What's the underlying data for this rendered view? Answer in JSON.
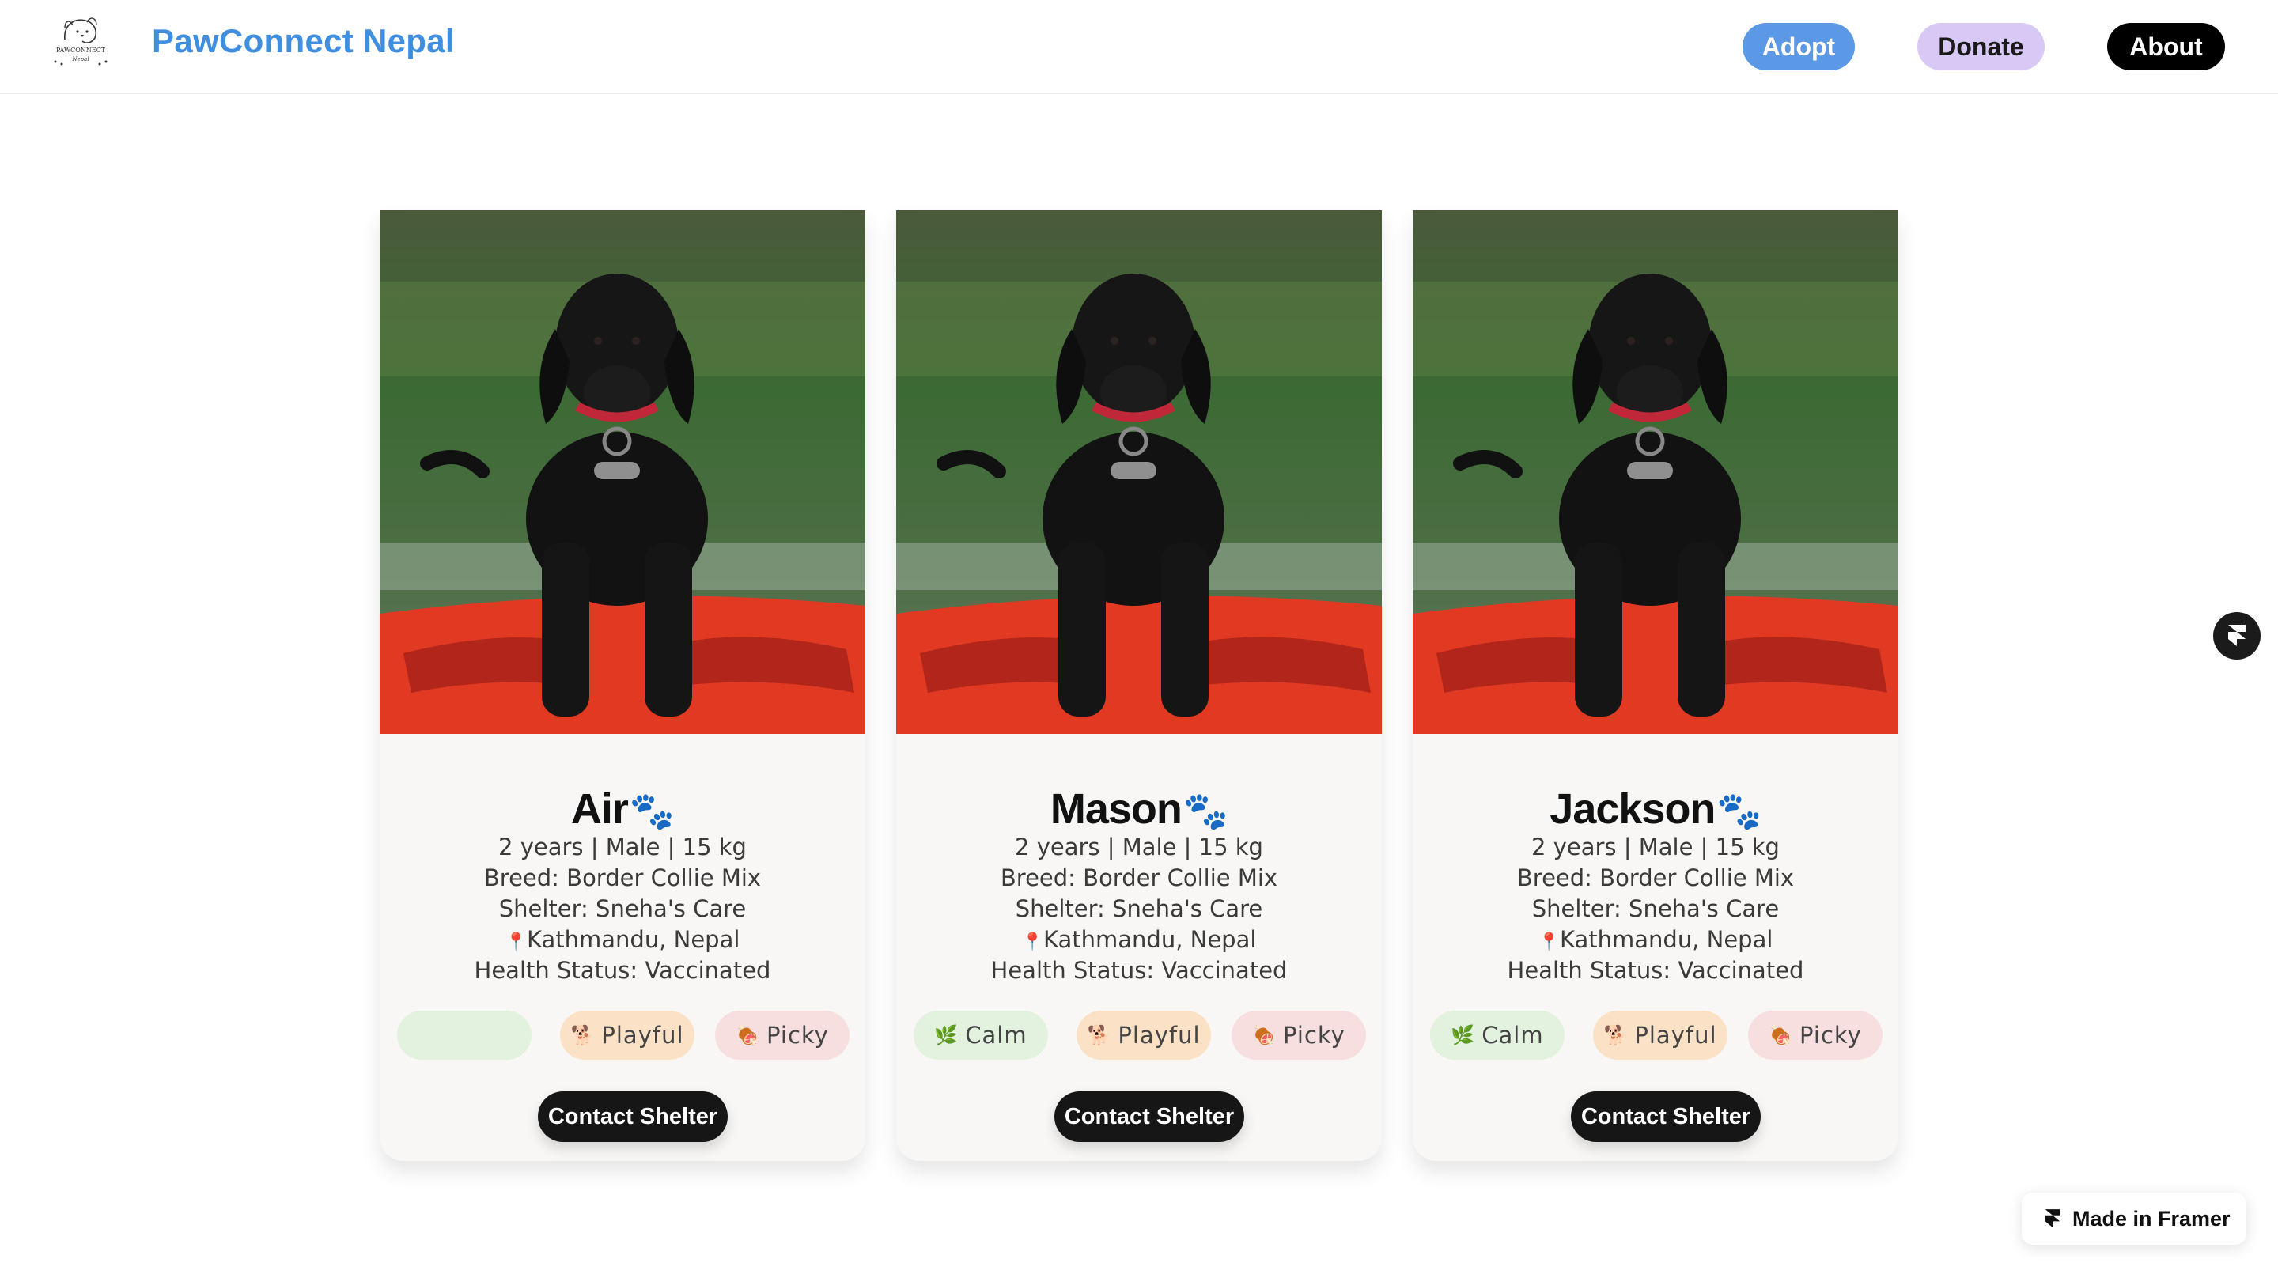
{
  "header": {
    "logo_text": "PAWCONNECT Nepal",
    "brand": "PawConnect Nepal",
    "nav": {
      "adopt": "Adopt",
      "donate": "Donate",
      "about": "About"
    }
  },
  "cards": [
    {
      "name": "Air",
      "paw": "🐾",
      "details": "2 years | Male | 15 kg",
      "breed": "Breed: Border Collie Mix",
      "shelter": "Shelter: Sneha's Care",
      "location_icon": "📍",
      "location": "Kathmandu, Nepal",
      "health": "Health Status: Vaccinated",
      "tags": {
        "calm": "",
        "calm_icon": "",
        "playful": "Playful",
        "playful_icon": "🐕",
        "picky": "Picky",
        "picky_icon": "🍖"
      },
      "button": "Contact Shelter"
    },
    {
      "name": "Mason",
      "paw": "🐾",
      "details": "2 years | Male | 15 kg",
      "breed": "Breed: Border Collie Mix",
      "shelter": "Shelter: Sneha's Care",
      "location_icon": "📍",
      "location": "Kathmandu, Nepal",
      "health": "Health Status: Vaccinated",
      "tags": {
        "calm": "Calm",
        "calm_icon": "🌿",
        "playful": "Playful",
        "playful_icon": "🐕",
        "picky": "Picky",
        "picky_icon": "🍖"
      },
      "button": "Contact Shelter"
    },
    {
      "name": "Jackson",
      "paw": "🐾",
      "details": "2 years | Male | 15 kg",
      "breed": "Breed: Border Collie Mix",
      "shelter": "Shelter: Sneha's Care",
      "location_icon": "📍",
      "location": "Kathmandu, Nepal",
      "health": "Health Status: Vaccinated",
      "tags": {
        "calm": "Calm",
        "calm_icon": "🌿",
        "playful": "Playful",
        "playful_icon": "🐕",
        "picky": "Picky",
        "picky_icon": "🍖"
      },
      "button": "Contact Shelter"
    }
  ],
  "framer_badge": "Made in Framer",
  "colors": {
    "brand": "#3f8ee0",
    "adopt": "#5b98e6",
    "donate": "#d8c8f5",
    "about": "#000000",
    "calm_tag": "#e2f2de",
    "playful_tag": "#fbe2c6",
    "picky_tag": "#f8dfdf"
  },
  "icons": {
    "logo": "dog-line-logo",
    "floating": "framer-icon",
    "badge": "framer-icon"
  }
}
